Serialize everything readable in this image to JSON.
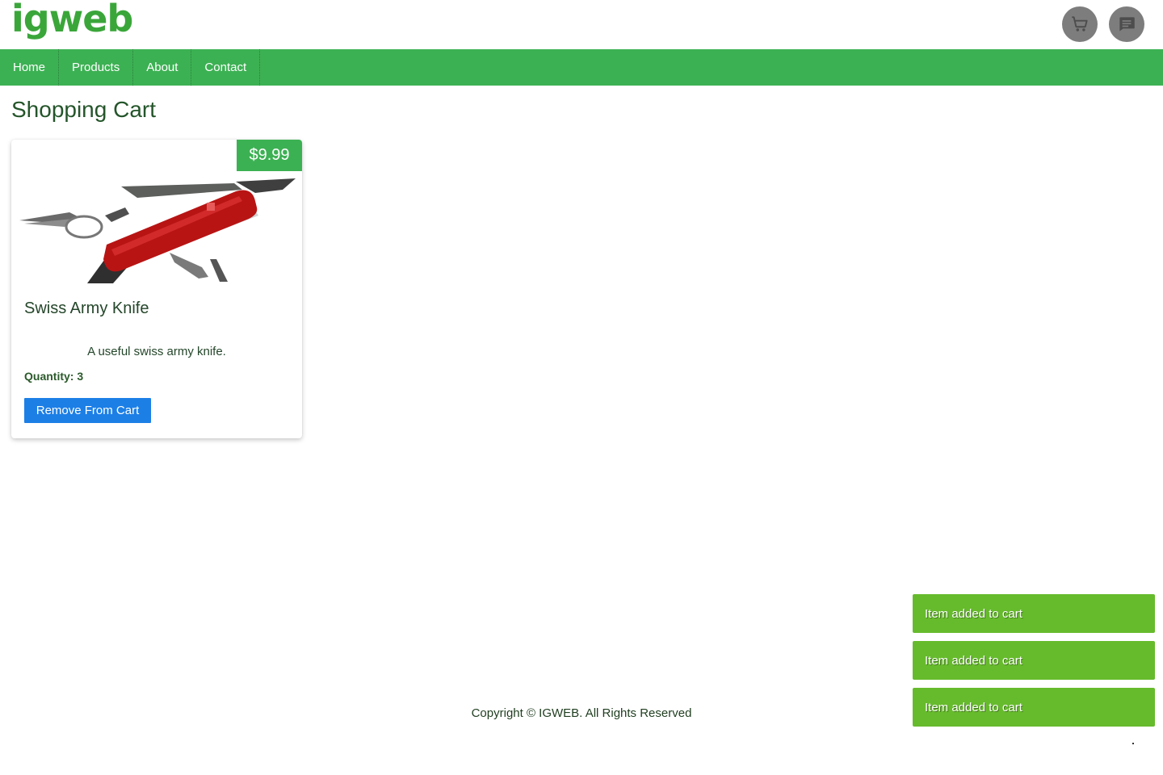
{
  "header": {
    "logo": "igweb",
    "cart_icon": "cart-icon",
    "chat_icon": "chat-icon"
  },
  "nav": {
    "items": [
      {
        "label": "Home"
      },
      {
        "label": "Products"
      },
      {
        "label": "About"
      },
      {
        "label": "Contact"
      }
    ]
  },
  "page": {
    "title": "Shopping Cart"
  },
  "cart": {
    "items": [
      {
        "price": "$9.99",
        "name": "Swiss Army Knife",
        "description": "A useful swiss army knife.",
        "quantity_label": "Quantity: 3",
        "remove_label": "Remove From Cart"
      }
    ]
  },
  "footer": {
    "copyright": "Copyright © IGWEB. All Rights Reserved"
  },
  "notifications": [
    {
      "message": "Item added to cart"
    },
    {
      "message": "Item added to cart"
    },
    {
      "message": "Item added to cart"
    }
  ],
  "colors": {
    "brand_green": "#3cb153",
    "logo_green": "#3aa63a",
    "button_blue": "#1c7fe6",
    "toast_green": "#66bb2c"
  }
}
